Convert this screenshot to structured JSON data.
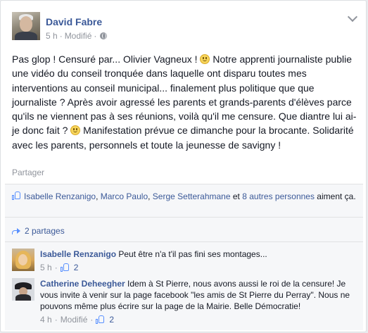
{
  "post": {
    "author": "David Fabre",
    "time": "5 h",
    "separator": "·",
    "edited": "Modifié",
    "text_parts": [
      "Pas glop ! Censuré par... Olivier Vagneux ! ",
      " Notre apprenti journaliste publie une vidéo du conseil tronquée dans laquelle ont disparu toutes mes interventions au conseil municipal... finalement plus politique que que journaliste ? Après avoir agressé les parents et grands-parents d'élèves parce qu'ils ne viennent pas à ses réunions, voilà qu'il me censure. Que diantre lui ai-je donc fait ? ",
      " Manifestation prévue ce dimanche pour la brocante. Solidarité avec les parents, personnels et toute la jeunesse de savigny !"
    ],
    "share_label": "Partager"
  },
  "likes": {
    "names": [
      "Isabelle Renzanigo",
      "Marco Paulo",
      "Serge Setterahmane"
    ],
    "comma": ", ",
    "and": " et ",
    "others": "8 autres personnes",
    "suffix": " aiment ça."
  },
  "shares": {
    "label": "2 partages"
  },
  "comments": [
    {
      "author": "Isabelle Renzanigo",
      "text": "Peut être n'a t'il pas fini ses montages...",
      "time": "5 h",
      "separator": "·",
      "like_count": "2"
    },
    {
      "author": "Catherine Deheegher",
      "text": "Idem à St Pierre, nous avons aussi le roi de la censure! Je vous invite à venir sur la page facebook \"les amis de St Pierre du Perray\". Nous ne pouvons même plus écrire sur la page de la Mairie. Belle Démocratie!",
      "time": "4 h",
      "separator": "·",
      "edited": "Modifié",
      "like_count": "2"
    }
  ],
  "icons": {
    "author_avatar": "avatar",
    "privacy": "globe-icon",
    "menu": "chevron-down-icon",
    "emoji": "smiley-icon",
    "like": "like-icon",
    "share": "share-icon"
  },
  "colors": {
    "link": "#3b5998",
    "muted": "#90949c",
    "text": "#141823",
    "ufi_background": "#f6f7f9"
  }
}
